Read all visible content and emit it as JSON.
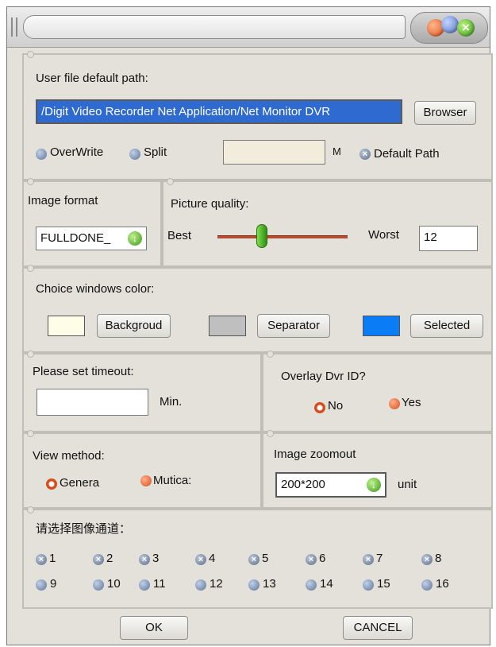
{
  "colors": {
    "background_swatch": "#fdfde8",
    "separator_swatch": "#bfbfbf",
    "selected_swatch": "#0a7cf5"
  },
  "path_section": {
    "title": "User file default path:",
    "path_value": "/Digit Video Recorder Net Application/Net Monitor DVR",
    "browse_label": "Browser",
    "overwrite_label": "OverWrite",
    "split_label": "Split",
    "size_value": "",
    "size_unit": "M",
    "default_path_label": "Default Path"
  },
  "image_format": {
    "title": "Image format",
    "value": "FULLDONE_"
  },
  "picture_quality": {
    "title": "Picture quality:",
    "best_label": "Best",
    "worst_label": "Worst",
    "value": "12",
    "slider_fraction": 0.31
  },
  "window_color": {
    "title": "Choice windows color:",
    "background_label": "Backgroud",
    "separator_label": "Separator",
    "selected_label": "Selected"
  },
  "timeout": {
    "title": "Please set timeout:",
    "value": "",
    "unit": "Min."
  },
  "overlay": {
    "title": "Overlay Dvr ID?",
    "no_label": "No",
    "yes_label": "Yes",
    "selected": "No"
  },
  "view_method": {
    "title": "View method:",
    "general_label": "Genera",
    "multicast_label": "Mutica:",
    "selected": "General"
  },
  "zoomout": {
    "title": "Image zoomout",
    "value": "200*200",
    "unit": "unit"
  },
  "channels": {
    "title": "请选择图像通道：",
    "row1": [
      "1",
      "2",
      "3",
      "4",
      "5",
      "6",
      "7",
      "8"
    ],
    "row2": [
      "9",
      "10",
      "11",
      "12",
      "13",
      "14",
      "15",
      "16"
    ]
  },
  "footer": {
    "ok_label": "OK",
    "cancel_label": "CANCEL"
  }
}
